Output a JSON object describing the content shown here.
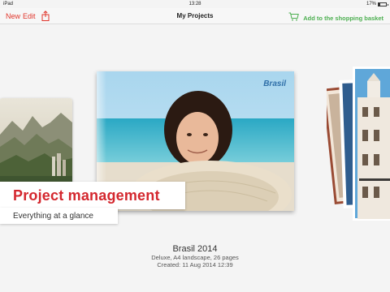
{
  "status_bar": {
    "carrier": "iPad",
    "time": "13:28",
    "battery": "17%"
  },
  "nav": {
    "new_label": "New",
    "edit_label": "Edit",
    "title": "My Projects",
    "cart_label": "Add to the shopping basket"
  },
  "main_book": {
    "cover_title": "Brasil"
  },
  "promo": {
    "headline": "Project management",
    "subline": "Everything at a glance"
  },
  "project_info": {
    "name": "Brasil 2014",
    "details": "Deluxe, A4 landscape, 26 pages",
    "created": "Created: 11 Aug 2014 12:39"
  },
  "colors": {
    "accent_red": "#e0352b",
    "cart_green": "#4caf50"
  },
  "icons": [
    "share-icon",
    "cart-icon",
    "battery-icon"
  ]
}
